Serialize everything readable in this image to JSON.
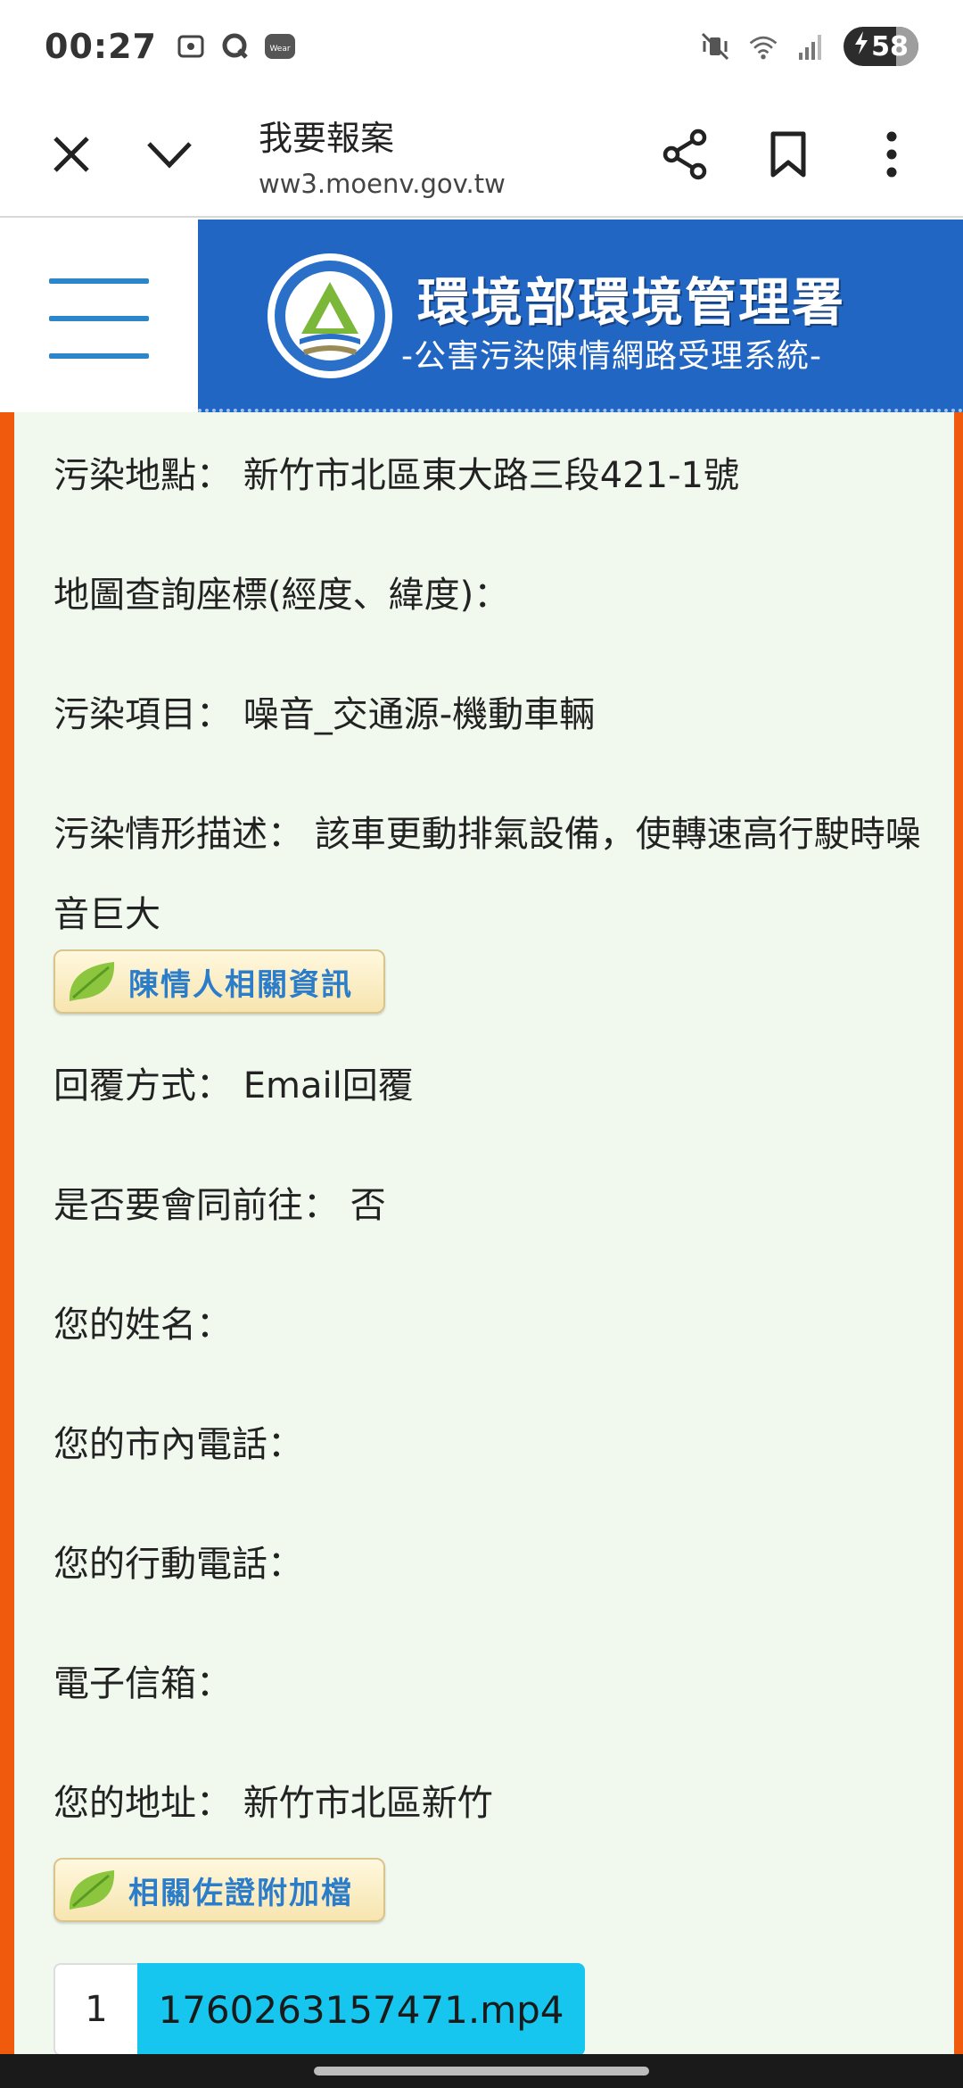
{
  "status_bar": {
    "time": "00:27",
    "battery": "58",
    "icons": [
      "screenshot-icon",
      "q-app-icon",
      "wear-icon",
      "mute-vibrate-icon",
      "wifi-icon",
      "signal-icon",
      "battery-charging-icon"
    ],
    "wear_label": "Wear"
  },
  "toolbar": {
    "page_title": "我要報案",
    "url": "ww3.moenv.gov.tw"
  },
  "header": {
    "title": "環境部環境管理署",
    "subtitle": "-公害污染陳情網路受理系統-"
  },
  "form": {
    "location": {
      "label": "污染地點：",
      "value": "新竹市北區東大路三段421-1號"
    },
    "coords": {
      "label": "地圖查詢座標(經度、緯度)：",
      "value": ""
    },
    "item": {
      "label": "污染項目：",
      "value": "噪音_交通源-機動車輛"
    },
    "description": {
      "label": "污染情形描述：",
      "value": "該車更動排氣設備，使轉速高行駛時噪音巨大"
    },
    "petitioner_button": "陳情人相關資訊",
    "reply": {
      "label": "回覆方式：",
      "value": "Email回覆"
    },
    "accompany": {
      "label": "是否要會同前往：",
      "value": "否"
    },
    "name": {
      "label": "您的姓名：",
      "value": ""
    },
    "phone": {
      "label": "您的市內電話：",
      "value": ""
    },
    "mobile": {
      "label": "您的行動電話：",
      "value": ""
    },
    "email": {
      "label": "電子信箱：",
      "value": ""
    },
    "address": {
      "label": "您的地址：",
      "value": "新竹市北區新竹"
    },
    "evidence_button": "相關佐證附加檔",
    "file": {
      "index": "1",
      "name": "1760263157471.mp4"
    }
  }
}
